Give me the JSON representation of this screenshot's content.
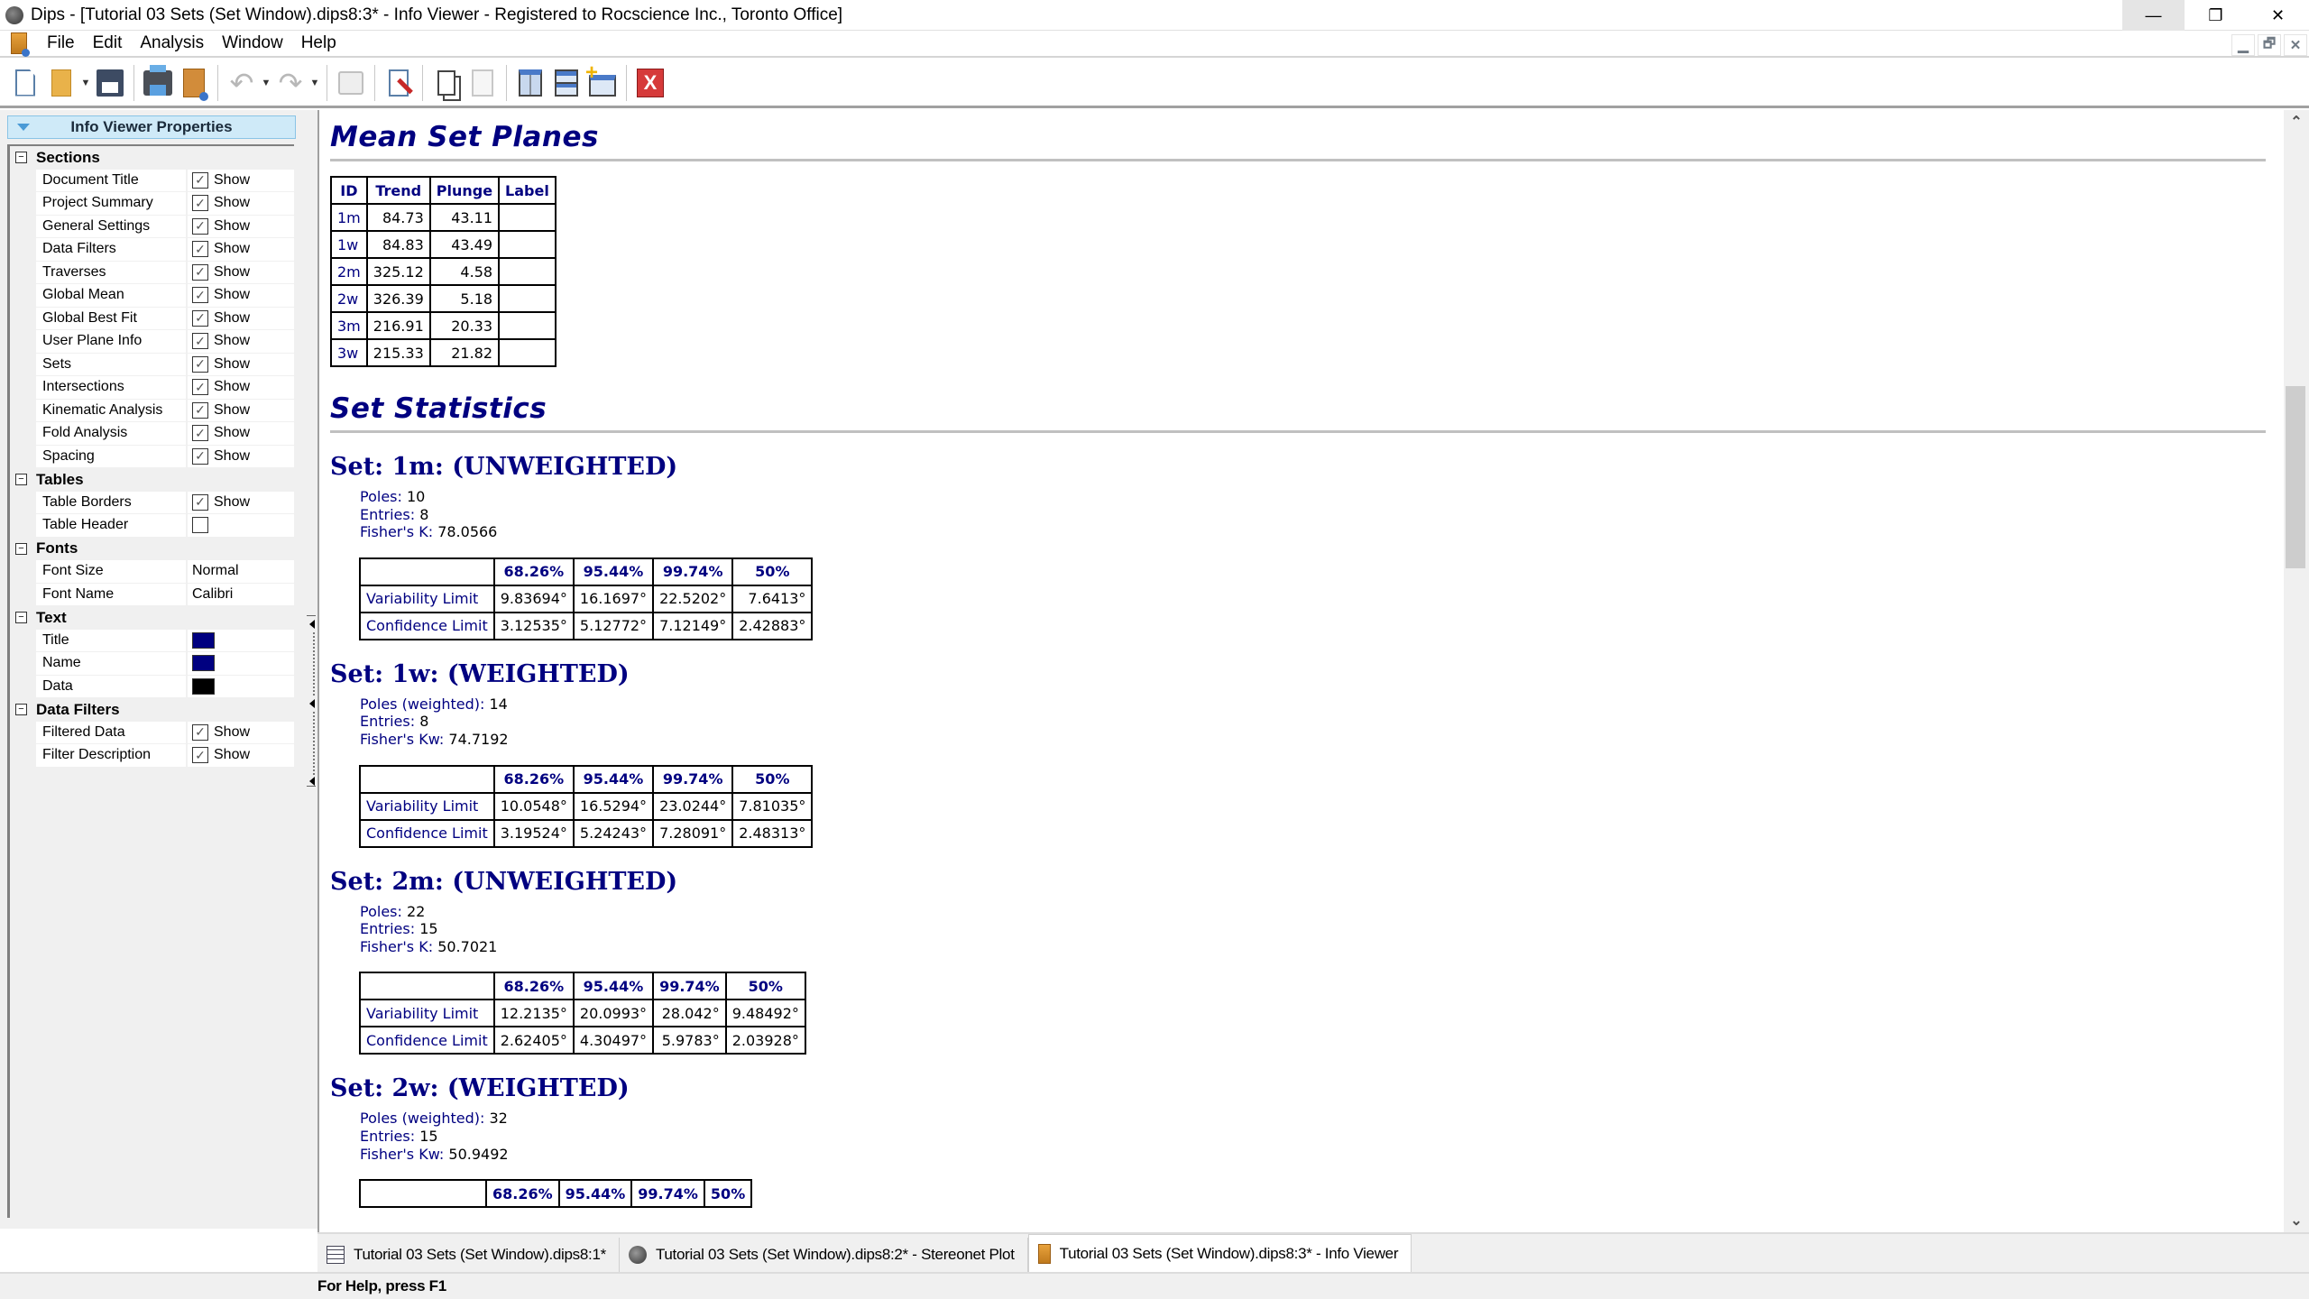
{
  "window": {
    "title": "Dips - [Tutorial 03 Sets (Set Window).dips8:3* - Info Viewer - Registered to Rocscience Inc., Toronto Office]",
    "controls": {
      "minimize": "—",
      "restore": "❐",
      "close": "✕"
    },
    "mdi_controls": {
      "minimize": "▁",
      "restore": "🗗",
      "close": "✕"
    }
  },
  "menu": [
    "File",
    "Edit",
    "Analysis",
    "Window",
    "Help"
  ],
  "toolbar": {
    "buttons": [
      "new-document",
      "open-folder",
      "save",
      "print",
      "info-viewer",
      "undo",
      "redo",
      "presentation",
      "edit-document",
      "copy",
      "paste",
      "tile-vertically",
      "tile-horizontally",
      "new-window",
      "close-window"
    ],
    "undo_glyph": "↶",
    "redo_glyph": "↷",
    "dropdown_glyph": "▼",
    "close_glyph": "X"
  },
  "sidebar": {
    "title": "Info Viewer Properties",
    "collapse_glyph": "−",
    "check_glyph": "✓",
    "show_label": "Show",
    "categories": [
      {
        "name": "Sections",
        "rows": [
          {
            "label": "Document Title",
            "type": "check",
            "checked": true
          },
          {
            "label": "Project Summary",
            "type": "check",
            "checked": true
          },
          {
            "label": "General Settings",
            "type": "check",
            "checked": true
          },
          {
            "label": "Data Filters",
            "type": "check",
            "checked": true
          },
          {
            "label": "Traverses",
            "type": "check",
            "checked": true
          },
          {
            "label": "Global Mean",
            "type": "check",
            "checked": true
          },
          {
            "label": "Global Best Fit",
            "type": "check",
            "checked": true
          },
          {
            "label": "User Plane Info",
            "type": "check",
            "checked": true
          },
          {
            "label": "Sets",
            "type": "check",
            "checked": true
          },
          {
            "label": "Intersections",
            "type": "check",
            "checked": true
          },
          {
            "label": "Kinematic Analysis",
            "type": "check",
            "checked": true
          },
          {
            "label": "Fold Analysis",
            "type": "check",
            "checked": true
          },
          {
            "label": "Spacing",
            "type": "check",
            "checked": true
          }
        ]
      },
      {
        "name": "Tables",
        "rows": [
          {
            "label": "Table Borders",
            "type": "check",
            "checked": true
          },
          {
            "label": "Table Header",
            "type": "check",
            "checked": false
          }
        ]
      },
      {
        "name": "Fonts",
        "rows": [
          {
            "label": "Font Size",
            "type": "text",
            "value": "Normal"
          },
          {
            "label": "Font Name",
            "type": "text",
            "value": "Calibri"
          }
        ]
      },
      {
        "name": "Text",
        "rows": [
          {
            "label": "Title",
            "type": "color",
            "value": "#000080"
          },
          {
            "label": "Name",
            "type": "color",
            "value": "#000080"
          },
          {
            "label": "Data",
            "type": "color",
            "value": "#000000"
          }
        ]
      },
      {
        "name": "Data Filters",
        "rows": [
          {
            "label": "Filtered Data",
            "type": "check",
            "checked": true
          },
          {
            "label": "Filter Description",
            "type": "check",
            "checked": true
          }
        ]
      }
    ]
  },
  "content": {
    "mean_set_planes": {
      "title": "Mean Set Planes",
      "headers": [
        "ID",
        "Trend",
        "Plunge",
        "Label"
      ],
      "rows": [
        [
          "1m",
          "84.73",
          "43.11",
          ""
        ],
        [
          "1w",
          "84.83",
          "43.49",
          ""
        ],
        [
          "2m",
          "325.12",
          "4.58",
          ""
        ],
        [
          "2w",
          "326.39",
          "5.18",
          ""
        ],
        [
          "3m",
          "216.91",
          "20.33",
          ""
        ],
        [
          "3w",
          "215.33",
          "21.82",
          ""
        ]
      ]
    },
    "set_statistics": {
      "title": "Set Statistics",
      "col_headers": [
        "",
        "68.26%",
        "95.44%",
        "99.74%",
        "50%"
      ],
      "sets": [
        {
          "heading": "Set: 1m: (UNWEIGHTED)",
          "meta": [
            {
              "k": "Poles",
              "v": "10"
            },
            {
              "k": "Entries",
              "v": "8"
            },
            {
              "k": "Fisher's K",
              "v": "78.0566"
            }
          ],
          "rows": [
            [
              "Variability Limit",
              "9.83694°",
              "16.1697°",
              "22.5202°",
              "7.6413°"
            ],
            [
              "Confidence Limit",
              "3.12535°",
              "5.12772°",
              "7.12149°",
              "2.42883°"
            ]
          ]
        },
        {
          "heading": "Set: 1w: (WEIGHTED)",
          "meta": [
            {
              "k": "Poles (weighted)",
              "v": "14"
            },
            {
              "k": "Entries",
              "v": "8"
            },
            {
              "k": "Fisher's Kw",
              "v": "74.7192"
            }
          ],
          "rows": [
            [
              "Variability Limit",
              "10.0548°",
              "16.5294°",
              "23.0244°",
              "7.81035°"
            ],
            [
              "Confidence Limit",
              "3.19524°",
              "5.24243°",
              "7.28091°",
              "2.48313°"
            ]
          ]
        },
        {
          "heading": "Set: 2m: (UNWEIGHTED)",
          "meta": [
            {
              "k": "Poles",
              "v": "22"
            },
            {
              "k": "Entries",
              "v": "15"
            },
            {
              "k": "Fisher's K",
              "v": "50.7021"
            }
          ],
          "rows": [
            [
              "Variability Limit",
              "12.2135°",
              "20.0993°",
              "28.042°",
              "9.48492°"
            ],
            [
              "Confidence Limit",
              "2.62405°",
              "4.30497°",
              "5.9783°",
              "2.03928°"
            ]
          ]
        },
        {
          "heading": "Set: 2w: (WEIGHTED)",
          "meta": [
            {
              "k": "Poles (weighted)",
              "v": "32"
            },
            {
              "k": "Entries",
              "v": "15"
            },
            {
              "k": "Fisher's Kw",
              "v": "50.9492"
            }
          ],
          "rows": []
        }
      ]
    }
  },
  "scrollbar": {
    "up_glyph": "⌃",
    "down_glyph": "⌄",
    "position_fraction": 0.25
  },
  "tabs": [
    {
      "label": "Tutorial 03 Sets (Set Window).dips8:1*",
      "icon": "spreadsheet-icon",
      "active": false
    },
    {
      "label": "Tutorial 03 Sets (Set Window).dips8:2* - Stereonet Plot",
      "icon": "globe-icon",
      "active": false
    },
    {
      "label": "Tutorial 03 Sets (Set Window).dips8:3* - Info Viewer",
      "icon": "info-viewer-icon",
      "active": true
    }
  ],
  "status": {
    "text": "For Help, press F1"
  }
}
